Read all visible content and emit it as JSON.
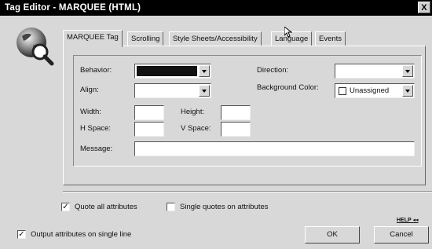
{
  "window": {
    "title": "Tag Editor - MARQUEE   (HTML)",
    "close_label": "X"
  },
  "tabs": [
    {
      "label": "MARQUEE Tag",
      "active": true
    },
    {
      "label": "Scrolling"
    },
    {
      "label": "Style Sheets/Accessibility"
    },
    {
      "label": "Language"
    },
    {
      "label": "Events"
    }
  ],
  "form": {
    "behavior_label": "Behavior:",
    "align_label": "Align:",
    "direction_label": "Direction:",
    "background_color_label": "Background Color:",
    "background_color_value": "Unassigned",
    "width_label": "Width:",
    "height_label": "Height:",
    "hspace_label": "H Space:",
    "vspace_label": "V Space:",
    "message_label": "Message:"
  },
  "options": {
    "quote_all": {
      "label": "Quote all attributes",
      "checked": true
    },
    "single_quotes": {
      "label": "Single quotes on attributes",
      "checked": false
    },
    "output_single_line": {
      "label": "Output attributes on single line",
      "checked": true
    }
  },
  "buttons": {
    "ok": "OK",
    "cancel": "Cancel",
    "help": "HELP"
  },
  "check_mark": "✓",
  "colors": {
    "titlebar": "#000000",
    "dialog_bg": "#d8d8d8",
    "field_bg": "#ffffff"
  }
}
